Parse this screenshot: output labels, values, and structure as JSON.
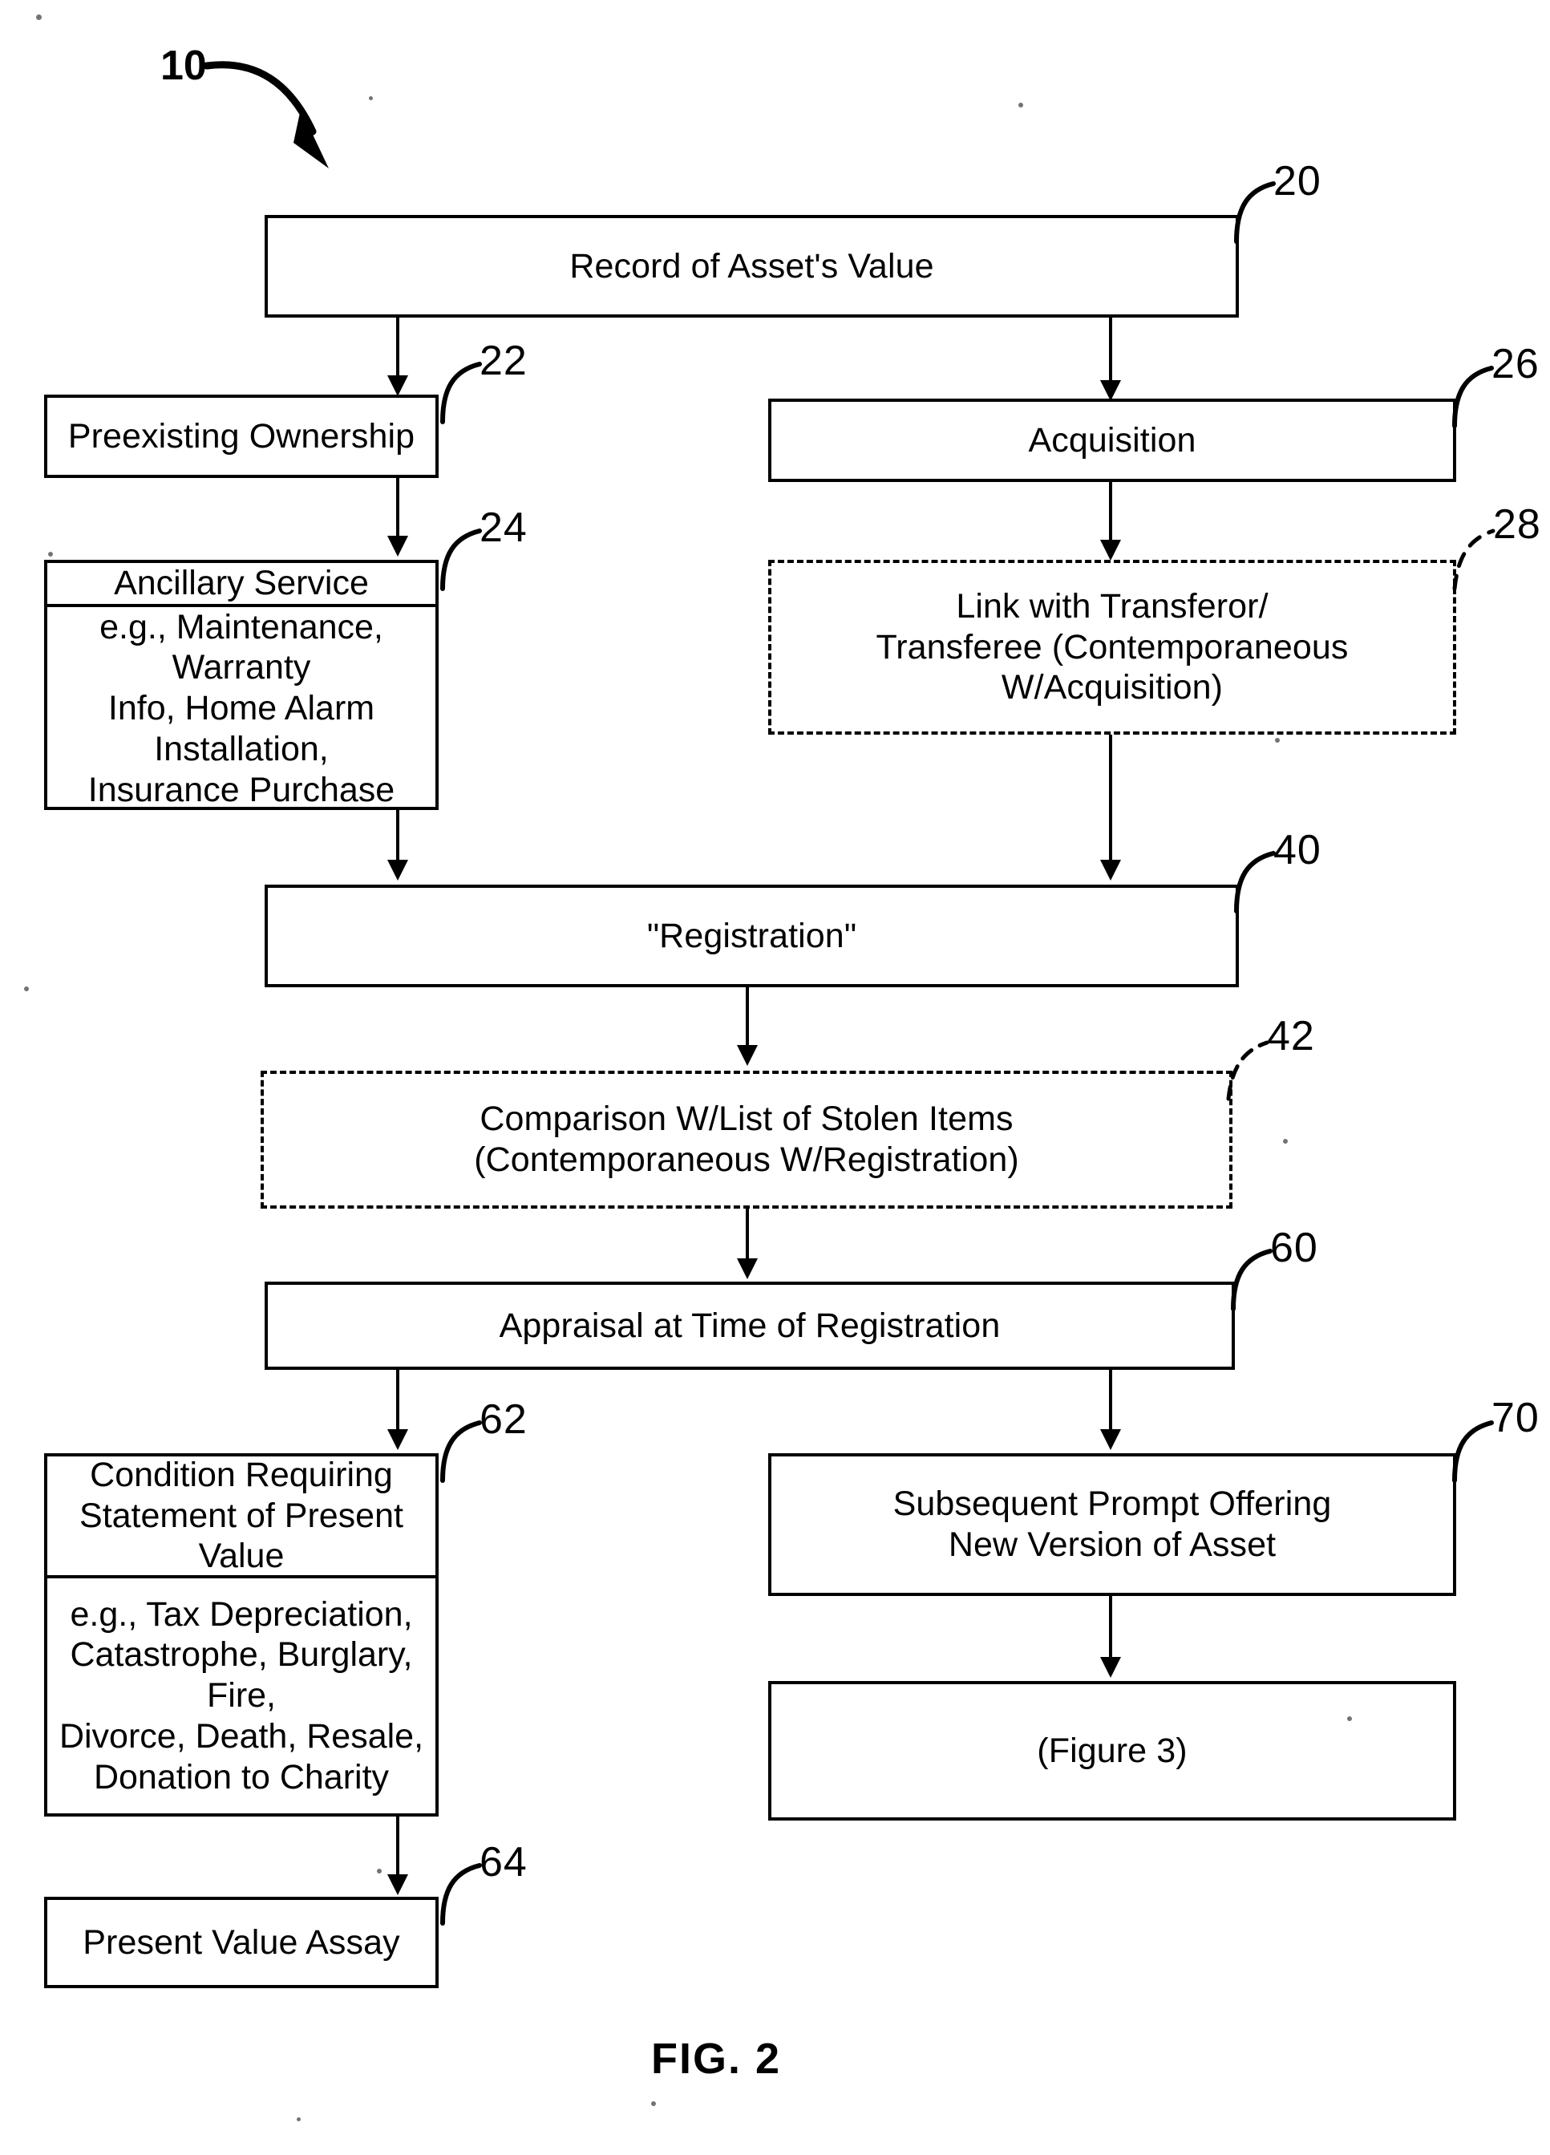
{
  "figure": {
    "caption": "FIG. 2",
    "system_numeral": "10"
  },
  "nodes": {
    "record_of_assets_value": {
      "label": "Record of Asset's Value",
      "numeral": "20",
      "style": "solid"
    },
    "preexisting_ownership": {
      "label": "Preexisting Ownership",
      "numeral": "22",
      "style": "solid"
    },
    "acquisition": {
      "label": "Acquisition",
      "numeral": "26",
      "style": "solid"
    },
    "ancillary_service": {
      "label": "Ancillary Service",
      "detail": "e.g., Maintenance, Warranty\nInfo, Home Alarm Installation,\nInsurance Purchase",
      "numeral": "24",
      "style": "solid-split"
    },
    "link_with_transferor": {
      "label": "Link with Transferor/\nTransferee (Contemporaneous\nW/Acquisition)",
      "numeral": "28",
      "style": "dashed"
    },
    "registration": {
      "label": "\"Registration\"",
      "numeral": "40",
      "style": "solid"
    },
    "comparison_stolen_items": {
      "label": "Comparison W/List of Stolen Items\n(Contemporaneous W/Registration)",
      "numeral": "42",
      "style": "dashed"
    },
    "appraisal_at_registration": {
      "label": "Appraisal at Time of Registration",
      "numeral": "60",
      "style": "solid"
    },
    "condition_requiring_statement": {
      "label": "Condition Requiring\nStatement of Present Value",
      "detail": "e.g., Tax Depreciation,\nCatastrophe, Burglary, Fire,\nDivorce, Death, Resale,\nDonation to Charity",
      "numeral": "62",
      "style": "solid-split"
    },
    "subsequent_prompt": {
      "label": "Subsequent Prompt Offering\nNew Version of Asset",
      "numeral": "70",
      "style": "solid"
    },
    "figure_three_ref": {
      "label": "(Figure 3)",
      "numeral": "",
      "style": "solid"
    },
    "present_value_assay": {
      "label": "Present Value Assay",
      "numeral": "64",
      "style": "solid"
    }
  },
  "colors": {
    "ink": "#000000",
    "paper": "#ffffff"
  }
}
